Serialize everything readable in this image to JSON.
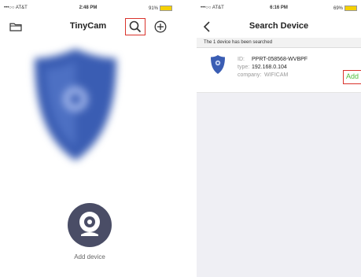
{
  "left_screen": {
    "status": {
      "carrier": "•••○○ AT&T",
      "time": "2:48 PM",
      "battery": "91%"
    },
    "nav": {
      "title": "TinyCam"
    },
    "icons": {
      "folder": "folder-icon",
      "search": "search-icon",
      "add": "add-circle-icon"
    },
    "add_device_label": "Add device",
    "colors": {
      "highlight": "#d9332c",
      "shield": "#3a5db3",
      "camera_button": "#4a4d66"
    }
  },
  "right_screen": {
    "status": {
      "carrier": "•••○○ AT&T",
      "time": "6:16 PM",
      "battery": "69%"
    },
    "nav": {
      "title": "Search Device"
    },
    "banner": "The 1 device has been searched",
    "device": {
      "id_label": "ID:",
      "id": "PPRT-058568-WVBPF",
      "type_label": "type:",
      "type": "192.168.0.104",
      "company_label": "company:",
      "company": "WIFICAM"
    },
    "add_label": "Add",
    "colors": {
      "add_text": "#4fbf3c",
      "highlight": "#d9332c"
    }
  }
}
